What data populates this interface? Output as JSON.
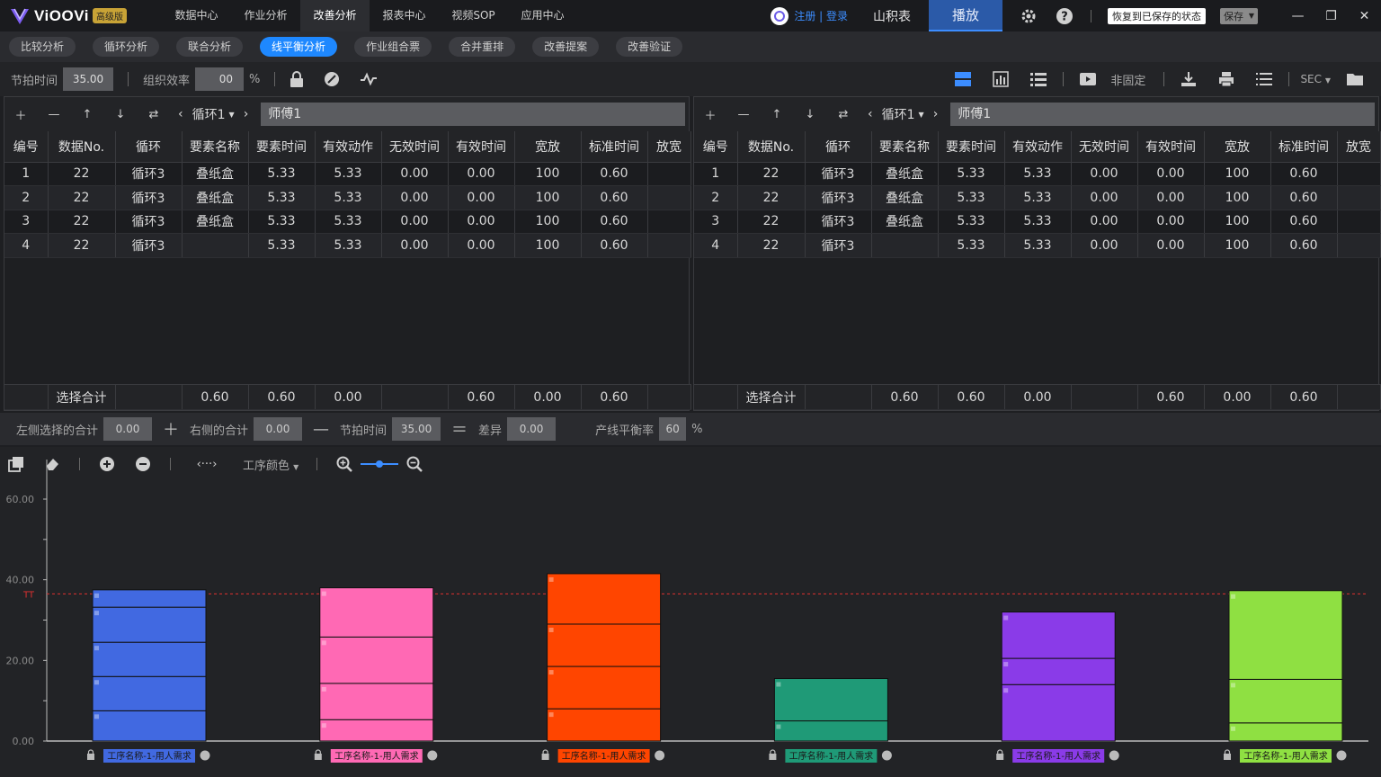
{
  "app": {
    "logo_text": "ViOOVi",
    "badge": "高级版",
    "nav": [
      "数据中心",
      "作业分析",
      "改善分析",
      "报表中心",
      "视频SOP",
      "应用中心"
    ],
    "nav_active": 2,
    "login": "注册 | 登录",
    "yamazumi": "山积表",
    "play": "播放",
    "restore": "恢复到已保存的状态",
    "save": "保存"
  },
  "subtabs": [
    "比较分析",
    "循环分析",
    "联合分析",
    "线平衡分析",
    "作业组合票",
    "合并重排",
    "改善提案",
    "改善验证"
  ],
  "subtab_active": 3,
  "toolbar": {
    "takt_label": "节拍时间",
    "takt_value": "35.00",
    "eff_label": "组织效率",
    "eff_value": "00",
    "eff_unit": "%",
    "non_fixed": "非固定",
    "unit": "SEC"
  },
  "left_panel": {
    "cycle": "循环1",
    "master": "师傅1",
    "columns": [
      "编号",
      "数据No.",
      "循环",
      "要素名称",
      "要素时间",
      "有效动作",
      "无效时间",
      "有效时间",
      "宽放",
      "标准时间",
      "放宽"
    ],
    "rows": [
      [
        "1",
        "22",
        "循环3",
        "叠纸盒",
        "5.33",
        "5.33",
        "0.00",
        "0.00",
        "100",
        "0.60",
        ""
      ],
      [
        "2",
        "22",
        "循环3",
        "叠纸盒",
        "5.33",
        "5.33",
        "0.00",
        "0.00",
        "100",
        "0.60",
        ""
      ],
      [
        "3",
        "22",
        "循环3",
        "叠纸盒",
        "5.33",
        "5.33",
        "0.00",
        "0.00",
        "100",
        "0.60",
        ""
      ],
      [
        "4",
        "22",
        "循环3",
        "",
        "5.33",
        "5.33",
        "0.00",
        "0.00",
        "100",
        "0.60",
        ""
      ]
    ],
    "footer": [
      "",
      "选择合计",
      "",
      "0.60",
      "0.60",
      "0.00",
      "",
      "0.60",
      "0.00",
      "0.60",
      ""
    ]
  },
  "right_panel": {
    "cycle": "循环1",
    "master": "师傅1",
    "columns": [
      "编号",
      "数据No.",
      "循环",
      "要素名称",
      "要素时间",
      "有效动作",
      "无效时间",
      "有效时间",
      "宽放",
      "标准时间",
      "放宽"
    ],
    "rows": [
      [
        "1",
        "22",
        "循环3",
        "叠纸盒",
        "5.33",
        "5.33",
        "0.00",
        "0.00",
        "100",
        "0.60",
        ""
      ],
      [
        "2",
        "22",
        "循环3",
        "叠纸盒",
        "5.33",
        "5.33",
        "0.00",
        "0.00",
        "100",
        "0.60",
        ""
      ],
      [
        "3",
        "22",
        "循环3",
        "叠纸盒",
        "5.33",
        "5.33",
        "0.00",
        "0.00",
        "100",
        "0.60",
        ""
      ],
      [
        "4",
        "22",
        "循环3",
        "",
        "5.33",
        "5.33",
        "0.00",
        "0.00",
        "100",
        "0.60",
        ""
      ]
    ],
    "footer": [
      "",
      "选择合计",
      "",
      "0.60",
      "0.60",
      "0.00",
      "",
      "0.60",
      "0.00",
      "0.60",
      ""
    ]
  },
  "sumbar": {
    "left_label": "左侧选择的合计",
    "left_value": "0.00",
    "right_label": "右侧的合计",
    "right_value": "0.00",
    "takt_label": "节拍时间",
    "takt_value": "35.00",
    "diff_label": "差异",
    "diff_value": "0.00",
    "balance_label": "产线平衡率",
    "balance_value": "60",
    "balance_unit": "%"
  },
  "chart_toolbar": {
    "color_label": "工序颜色"
  },
  "chart_data": {
    "type": "bar",
    "ylim": [
      0,
      60
    ],
    "yticks": [
      "0.00",
      "20.00",
      "40.00",
      "60.00"
    ],
    "tt_label": "TT",
    "tt_value": 36.5,
    "bars": [
      {
        "label": "工序名称-1-用人需求",
        "color": "#4169e1",
        "segments": [
          7.5,
          8.5,
          8.5,
          8.7,
          4.3
        ]
      },
      {
        "label": "工序名称-1-用人需求",
        "color": "#ff69b4",
        "segments": [
          5.3,
          9.0,
          11.5,
          12.2
        ]
      },
      {
        "label": "工序名称-1-用人需求",
        "color": "#ff4500",
        "segments": [
          8.0,
          10.5,
          10.5,
          12.5
        ]
      },
      {
        "label": "工序名称-1-用人需求",
        "color": "#1f9a77",
        "segments": [
          5.0,
          10.5
        ]
      },
      {
        "label": "工序名称-1-用人需求",
        "color": "#8a3be8",
        "segments": [
          14.0,
          6.5,
          11.5
        ]
      },
      {
        "label": "工序名称-1-用人需求",
        "color": "#8fe042",
        "segments": [
          4.5,
          10.8,
          22.0
        ]
      }
    ]
  }
}
